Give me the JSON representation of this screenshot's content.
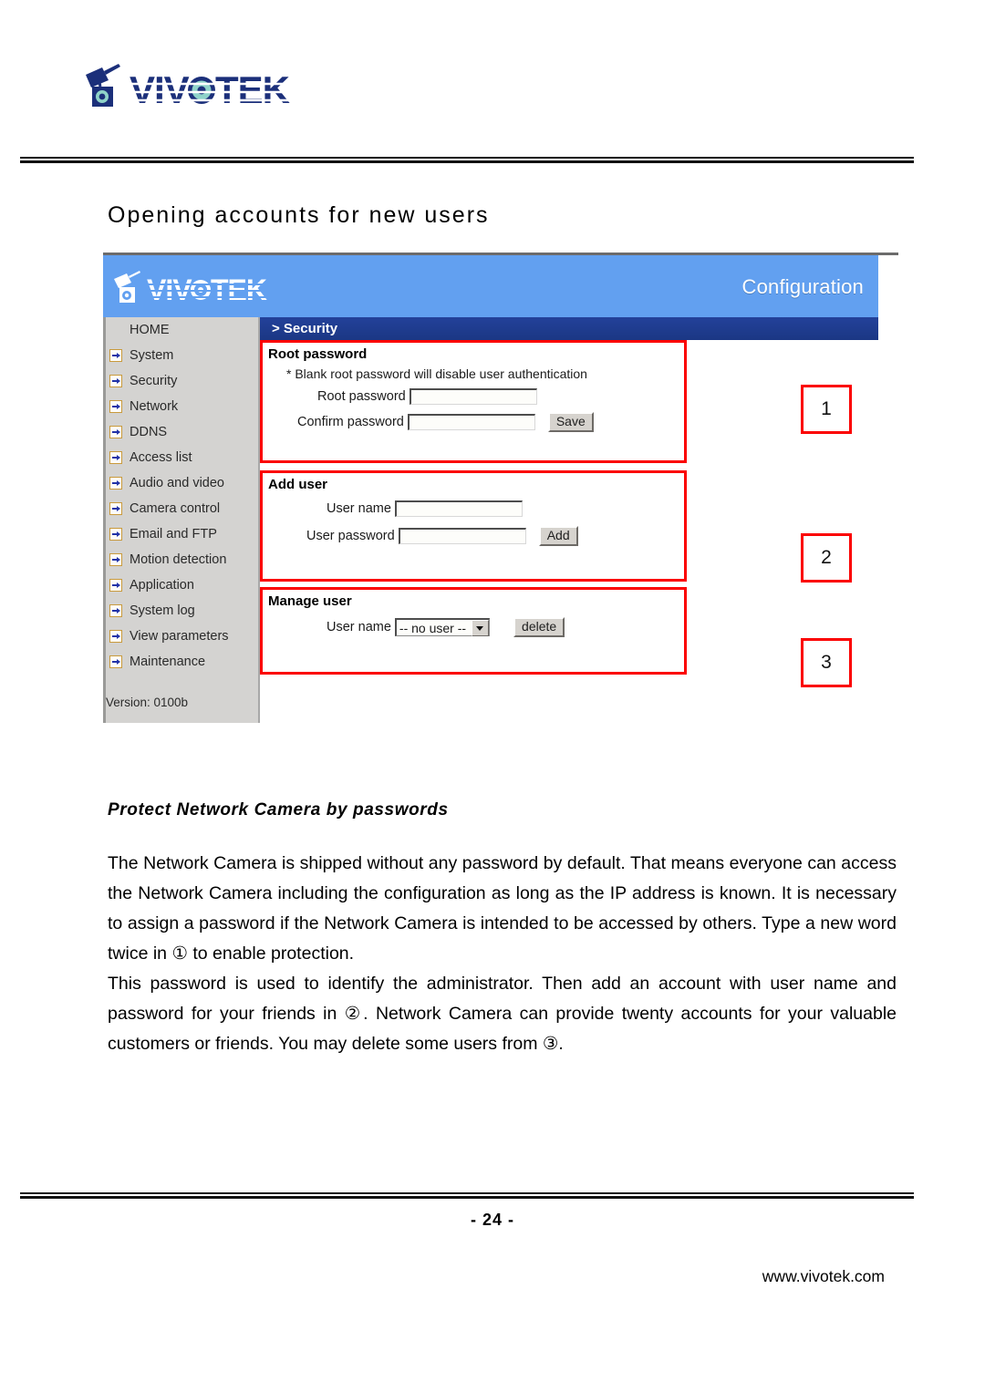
{
  "document": {
    "page_title": "Opening accounts for new users",
    "page_number": "- 24 -",
    "footer_url": "www.vivotek.com",
    "brand": "VIVOTEK"
  },
  "screenshot": {
    "header": {
      "logo_text": "VIVOTEK",
      "config_label": "Configuration",
      "bar_color": "#62a0f0"
    },
    "breadcrumb": {
      "text": "> Security",
      "bar_color": "#1f3f96"
    },
    "sidebar": {
      "items": [
        {
          "label": "HOME",
          "icon": ""
        },
        {
          "label": "System",
          "icon": "arrow-icon"
        },
        {
          "label": "Security",
          "icon": "arrow-icon"
        },
        {
          "label": "Network",
          "icon": "arrow-icon"
        },
        {
          "label": "DDNS",
          "icon": "arrow-icon"
        },
        {
          "label": "Access list",
          "icon": "arrow-icon"
        },
        {
          "label": "Audio and video",
          "icon": "arrow-icon"
        },
        {
          "label": "Camera control",
          "icon": "arrow-icon"
        },
        {
          "label": "Email and FTP",
          "icon": "arrow-icon"
        },
        {
          "label": "Motion detection",
          "icon": "arrow-icon"
        },
        {
          "label": "Application",
          "icon": "arrow-icon"
        },
        {
          "label": "System log",
          "icon": "arrow-icon"
        },
        {
          "label": "View parameters",
          "icon": "arrow-icon"
        },
        {
          "label": "Maintenance",
          "icon": "arrow-icon"
        }
      ],
      "version": "Version: 0100b"
    },
    "panels": {
      "root_password": {
        "title": "Root password",
        "note": "* Blank root password will disable user authentication",
        "field_1_label": "Root password",
        "field_1_value": "",
        "field_2_label": "Confirm password",
        "field_2_value": "",
        "save_label": "Save"
      },
      "add_user": {
        "title": "Add user",
        "field_1_label": "User name",
        "field_1_value": "",
        "field_2_label": "User password",
        "field_2_value": "",
        "add_label": "Add"
      },
      "manage_user": {
        "title": "Manage user",
        "field_1_label": "User name",
        "select_value": "-- no user --",
        "delete_label": "delete"
      }
    },
    "callouts": {
      "one": "1",
      "two": "2",
      "three": "3",
      "border_color": "#fb0000"
    }
  },
  "body": {
    "subheading": "Protect Network Camera by passwords",
    "paragraph_1": "The Network Camera is shipped without any password by default. That means everyone can access the Network Camera including the configuration as long as the IP address is known. It is necessary to assign a password if the Network Camera is intended to be accessed by others. Type a new word twice in ① to enable protection.",
    "paragraph_2": "This password is used to identify the administrator. Then add an account with user name and password for your friends in ②. Network Camera can provide twenty accounts for your valuable customers or friends. You may delete some users from ③."
  }
}
